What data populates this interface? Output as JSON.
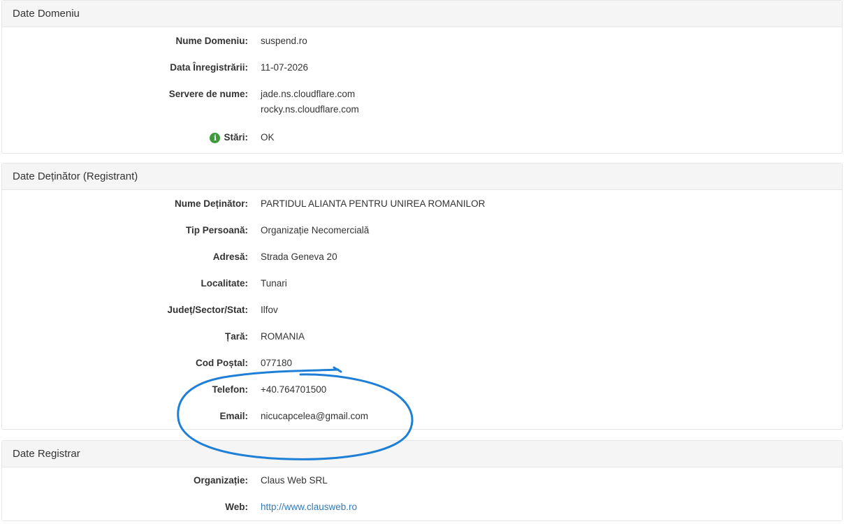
{
  "domain_panel": {
    "title": "Date Domeniu",
    "rows": [
      {
        "label": "Nume Domeniu:",
        "value": "suspend.ro"
      },
      {
        "label": "Data Înregistrării:",
        "value": "11-07-2026"
      },
      {
        "label": "Servere de nume:",
        "values": [
          "jade.ns.cloudflare.com",
          "rocky.ns.cloudflare.com"
        ]
      },
      {
        "label": "Stări:",
        "value": "OK",
        "icon": "info-icon"
      }
    ]
  },
  "registrant_panel": {
    "title": "Date Deținător (Registrant)",
    "rows": [
      {
        "label": "Nume Deținător:",
        "value": "PARTIDUL ALIANTA PENTRU UNIREA ROMANILOR"
      },
      {
        "label": "Tip Persoană:",
        "value": "Organizație Necomercială"
      },
      {
        "label": "Adresă:",
        "value": "Strada Geneva 20"
      },
      {
        "label": "Localitate:",
        "value": "Tunari"
      },
      {
        "label": "Județ/Sector/Stat:",
        "value": "Ilfov"
      },
      {
        "label": "Țară:",
        "value": "ROMANIA"
      },
      {
        "label": "Cod Poștal:",
        "value": "077180"
      },
      {
        "label": "Telefon:",
        "value": "+40.764701500"
      },
      {
        "label": "Email:",
        "value": "nicucapcelea@gmail.com"
      }
    ]
  },
  "registrar_panel": {
    "title": "Date Registrar",
    "rows": [
      {
        "label": "Organizație:",
        "value": "Claus Web SRL"
      },
      {
        "label": "Web:",
        "value": "http://www.clausweb.ro"
      }
    ]
  },
  "colors": {
    "link": "#337ab7",
    "info_icon": "#3c9a3c",
    "annotation_stroke": "#1e7fd6"
  }
}
